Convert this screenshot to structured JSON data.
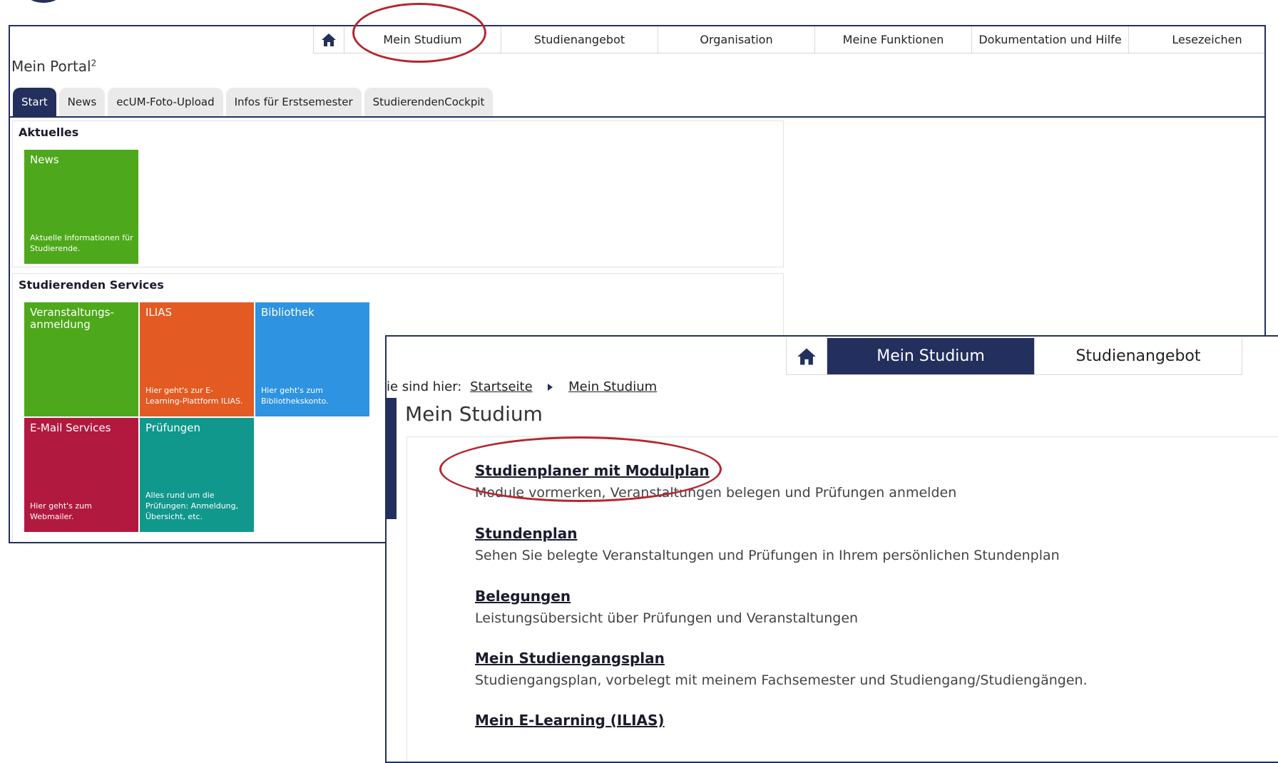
{
  "nav": {
    "items": [
      "Mein Studium",
      "Studienangebot",
      "Organisation",
      "Meine Funktionen",
      "Dokumentation und Hilfe",
      "Lesezeichen"
    ]
  },
  "portal": {
    "title": "Mein Portal",
    "title_sup": "2",
    "tabs": [
      "Start",
      "News",
      "ecUM-Foto-Upload",
      "Infos für Erstsemester",
      "StudierendenCockpit"
    ],
    "active_tab": "Start"
  },
  "aktuelles": {
    "heading": "Aktuelles",
    "tiles": [
      {
        "title": "News",
        "desc": "Aktuelle Informationen für Studierende.",
        "color": "#4ea81b"
      }
    ]
  },
  "services": {
    "heading": "Studierenden Services",
    "tiles": [
      {
        "title": "Veranstaltungs-anmeldung",
        "desc": "",
        "color": "#4ea81b"
      },
      {
        "title": "ILIAS",
        "desc": "Hier geht's zur E-Learning-Plattform ILIAS.",
        "color": "#e35a22"
      },
      {
        "title": "Bibliothek",
        "desc": "Hier geht's zum Bibliothekskonto.",
        "color": "#2e93e0"
      },
      {
        "title": "E-Mail Services",
        "desc": "Hier geht's zum Webmailer.",
        "color": "#b2193f"
      },
      {
        "title": "Prüfungen",
        "desc": "Alles rund um die Prüfungen: Anmeldung, Übersicht, etc.",
        "color": "#11988d"
      }
    ]
  },
  "detail": {
    "nav_items": [
      "Mein Studium",
      "Studienangebot"
    ],
    "active_nav": "Mein Studium",
    "breadcrumb": {
      "prefix": "ie sind hier:",
      "items": [
        "Startseite",
        "Mein Studium"
      ]
    },
    "page_title": "Mein Studium",
    "entries": [
      {
        "title": "Studienplaner mit Modulplan",
        "desc": "Module vormerken, Veranstaltungen belegen und Prüfungen anmelden"
      },
      {
        "title": "Stundenplan",
        "desc": "Sehen Sie belegte Veranstaltungen und Prüfungen in Ihrem persönlichen Stundenplan"
      },
      {
        "title": "Belegungen",
        "desc": "Leistungsübersicht über Prüfungen und Veranstaltungen"
      },
      {
        "title": "Mein Studiengangsplan",
        "desc": "Studiengangsplan, vorbelegt mit meinem Fachsemester und Studiengang/Studiengängen."
      },
      {
        "title": "Mein E-Learning (ILIAS)",
        "desc": ""
      }
    ]
  },
  "colors": {
    "primary": "#23305e",
    "highlight": "#b4272d"
  },
  "icons": {
    "home": "home-icon",
    "separator": "chevron-right-icon"
  }
}
